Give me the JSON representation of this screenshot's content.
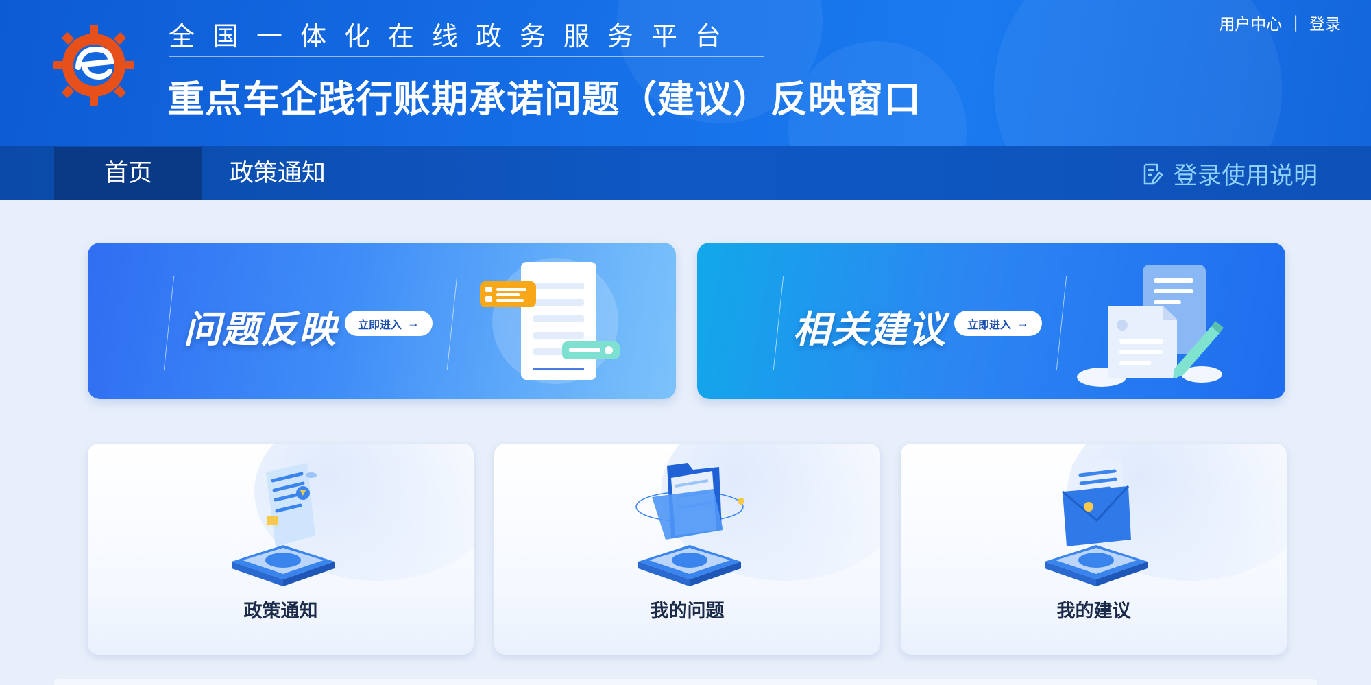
{
  "header": {
    "platform_name": "全国一体化在线政务服务平台",
    "site_title": "重点车企践行账期承诺问题（建议）反映窗口",
    "top_links": {
      "user_center": "用户中心",
      "separator": "|",
      "login": "登录"
    }
  },
  "nav": {
    "items": [
      {
        "label": "首页",
        "active": true
      },
      {
        "label": "政策通知",
        "active": false
      }
    ],
    "help_label": "登录使用说明",
    "help_icon": "edit-document-icon"
  },
  "banners": [
    {
      "title": "问题反映",
      "button_label": "立即进入",
      "button_icon": "arrow-right-icon",
      "illustration": "chat-document-icon"
    },
    {
      "title": "相关建议",
      "button_label": "立即进入",
      "button_icon": "arrow-right-icon",
      "illustration": "document-pen-icon"
    }
  ],
  "cards": [
    {
      "label": "政策通知",
      "illustration": "certificate-scroll-icon"
    },
    {
      "label": "我的问题",
      "illustration": "folder-icon"
    },
    {
      "label": "我的建议",
      "illustration": "mail-envelope-icon"
    }
  ],
  "colors": {
    "header_blue": "#1670e8",
    "nav_blue": "#0f58c4",
    "nav_active": "#0a3a86",
    "help_text": "#8fd0ff",
    "logo_orange": "#e8501a",
    "page_bg": "#e8effb"
  }
}
